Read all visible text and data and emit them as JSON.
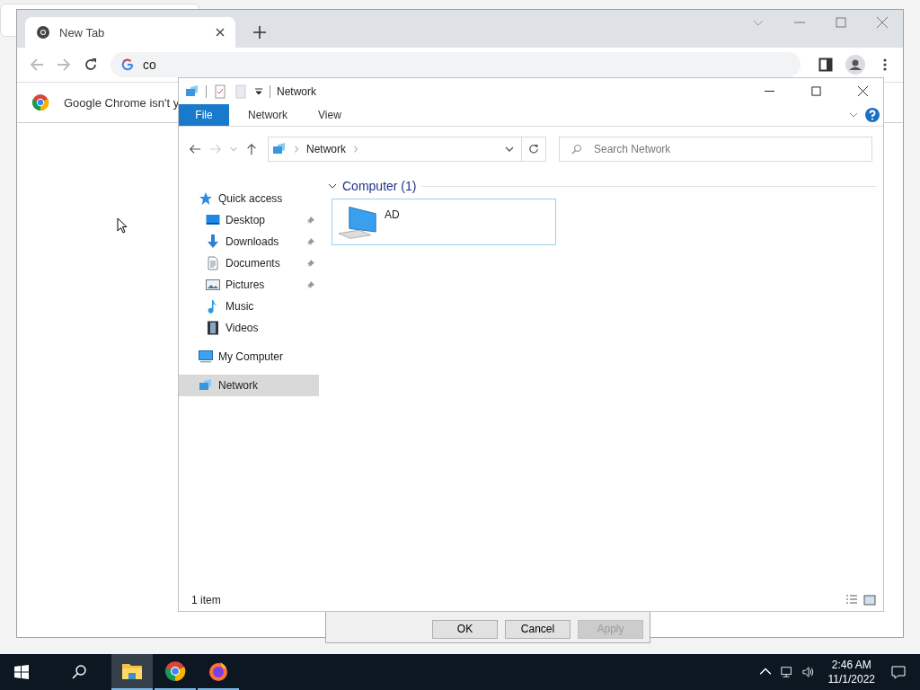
{
  "browser": {
    "tabs": [
      {
        "title": "New Tab",
        "selected": true
      }
    ],
    "address": "co",
    "infobar": "Google Chrome isn't y"
  },
  "explorer": {
    "title": "Network",
    "ribbon_tabs": [
      {
        "label": "File",
        "selected": true
      },
      {
        "label": "Network",
        "selected": false
      },
      {
        "label": "View",
        "selected": false
      }
    ],
    "breadcrumb": [
      "Network"
    ],
    "search": {
      "placeholder": "Search Network"
    },
    "nav": [
      {
        "label": "Quick access",
        "kind": "quick",
        "pinned": false,
        "selected": false,
        "children": [
          {
            "label": "Desktop",
            "kind": "desktop",
            "pinned": true,
            "selected": false
          },
          {
            "label": "Downloads",
            "kind": "downloads",
            "pinned": true,
            "selected": false
          },
          {
            "label": "Documents",
            "kind": "documents",
            "pinned": true,
            "selected": false
          },
          {
            "label": "Pictures",
            "kind": "pictures",
            "pinned": true,
            "selected": false
          },
          {
            "label": "Music",
            "kind": "music",
            "pinned": false,
            "selected": false
          },
          {
            "label": "Videos",
            "kind": "videos",
            "pinned": false,
            "selected": false
          }
        ]
      },
      {
        "label": "My Computer",
        "kind": "computer",
        "pinned": false,
        "selected": false
      },
      {
        "label": "Network",
        "kind": "network",
        "pinned": false,
        "selected": true
      }
    ],
    "group": {
      "title": "Computer (1)",
      "expanded": true
    },
    "items": [
      {
        "name": "AD",
        "selected": true
      }
    ],
    "status": "1 item"
  },
  "dialog": {
    "buttons": [
      {
        "label": "OK",
        "disabled": false
      },
      {
        "label": "Cancel",
        "disabled": false
      },
      {
        "label": "Apply",
        "disabled": true
      }
    ]
  },
  "taskbar": {
    "apps": [
      {
        "kind": "explorer",
        "selected": true
      },
      {
        "kind": "chrome",
        "selected": false
      },
      {
        "kind": "firefox",
        "selected": false
      }
    ],
    "time": "2:46 AM",
    "date": "11/1/2022"
  }
}
